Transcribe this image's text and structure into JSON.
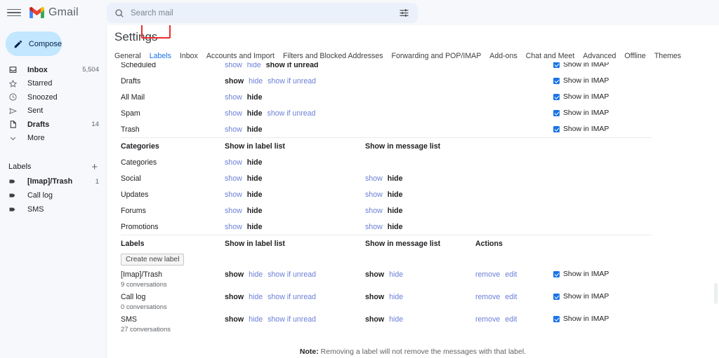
{
  "app": {
    "brand": "Gmail",
    "menu_icon": "hamburger-icon"
  },
  "search": {
    "placeholder": "Search mail",
    "value": "",
    "search_icon": "search-icon",
    "options_icon": "tune-icon"
  },
  "sidebar": {
    "compose": {
      "label": "Compose",
      "icon": "pencil-icon"
    },
    "nav": [
      {
        "label": "Inbox",
        "count": "5,504",
        "icon": "inbox-icon",
        "bold": true
      },
      {
        "label": "Starred",
        "count": "",
        "icon": "star-icon",
        "bold": false
      },
      {
        "label": "Snoozed",
        "count": "",
        "icon": "clock-icon",
        "bold": false
      },
      {
        "label": "Sent",
        "count": "",
        "icon": "send-icon",
        "bold": false
      },
      {
        "label": "Drafts",
        "count": "14",
        "icon": "draft-icon",
        "bold": true
      },
      {
        "label": "More",
        "count": "",
        "icon": "chevron-down-icon",
        "bold": false
      }
    ],
    "labels_header": {
      "title": "Labels",
      "add_icon": "plus-icon"
    },
    "labels": [
      {
        "label": "[Imap]/Trash",
        "count": "1",
        "bold": true
      },
      {
        "label": "Call log",
        "count": "",
        "bold": false
      },
      {
        "label": "SMS",
        "count": "",
        "bold": false
      }
    ]
  },
  "settings": {
    "title": "Settings",
    "tabs": [
      {
        "label": "General",
        "active": false
      },
      {
        "label": "Labels",
        "active": true
      },
      {
        "label": "Inbox",
        "active": false
      },
      {
        "label": "Accounts and Import",
        "active": false
      },
      {
        "label": "Filters and Blocked Addresses",
        "active": false
      },
      {
        "label": "Forwarding and POP/IMAP",
        "active": false
      },
      {
        "label": "Add-ons",
        "active": false
      },
      {
        "label": "Chat and Meet",
        "active": false
      },
      {
        "label": "Advanced",
        "active": false
      },
      {
        "label": "Offline",
        "active": false
      },
      {
        "label": "Themes",
        "active": false
      }
    ],
    "highlight_target": "Labels",
    "highlight_color": "#ee2b2b",
    "accent_color": "#1a73e8",
    "imap_checkbox_label": "Show in IMAP",
    "columns": {
      "show_in_label_list": "Show in label list",
      "show_in_message_list": "Show in message list",
      "actions": "Actions"
    },
    "system_rows": [
      {
        "name": "Scheduled",
        "list": [
          {
            "text": "show",
            "state": "link"
          },
          {
            "text": "hide",
            "state": "link"
          },
          {
            "text": "show if unread",
            "state": "selected"
          }
        ],
        "imap": true
      },
      {
        "name": "Drafts",
        "list": [
          {
            "text": "show",
            "state": "selected"
          },
          {
            "text": "hide",
            "state": "link"
          },
          {
            "text": "show if unread",
            "state": "link"
          }
        ],
        "imap": true
      },
      {
        "name": "All Mail",
        "list": [
          {
            "text": "show",
            "state": "link"
          },
          {
            "text": "hide",
            "state": "selected"
          }
        ],
        "imap": true
      },
      {
        "name": "Spam",
        "list": [
          {
            "text": "show",
            "state": "link"
          },
          {
            "text": "hide",
            "state": "selected"
          },
          {
            "text": "show if unread",
            "state": "link"
          }
        ],
        "imap": true
      },
      {
        "name": "Trash",
        "list": [
          {
            "text": "show",
            "state": "link"
          },
          {
            "text": "hide",
            "state": "selected"
          }
        ],
        "imap": true
      }
    ],
    "categories_section": {
      "header": "Categories",
      "rows": [
        {
          "name": "Categories",
          "list": [
            {
              "text": "show",
              "state": "link"
            },
            {
              "text": "hide",
              "state": "selected"
            }
          ],
          "msg": []
        },
        {
          "name": "Social",
          "list": [
            {
              "text": "show",
              "state": "link"
            },
            {
              "text": "hide",
              "state": "selected"
            }
          ],
          "msg": [
            {
              "text": "show",
              "state": "link"
            },
            {
              "text": "hide",
              "state": "selected"
            }
          ]
        },
        {
          "name": "Updates",
          "list": [
            {
              "text": "show",
              "state": "link"
            },
            {
              "text": "hide",
              "state": "selected"
            }
          ],
          "msg": [
            {
              "text": "show",
              "state": "link"
            },
            {
              "text": "hide",
              "state": "selected"
            }
          ]
        },
        {
          "name": "Forums",
          "list": [
            {
              "text": "show",
              "state": "link"
            },
            {
              "text": "hide",
              "state": "selected"
            }
          ],
          "msg": [
            {
              "text": "show",
              "state": "link"
            },
            {
              "text": "hide",
              "state": "selected"
            }
          ]
        },
        {
          "name": "Promotions",
          "list": [
            {
              "text": "show",
              "state": "link"
            },
            {
              "text": "hide",
              "state": "selected"
            }
          ],
          "msg": [
            {
              "text": "show",
              "state": "link"
            },
            {
              "text": "hide",
              "state": "selected"
            }
          ]
        }
      ]
    },
    "labels_section": {
      "header": "Labels",
      "create_button": "Create new label",
      "rows": [
        {
          "name": "[Imap]/Trash",
          "conversations": "9 conversations",
          "list": [
            {
              "text": "show",
              "state": "selected"
            },
            {
              "text": "hide",
              "state": "link"
            },
            {
              "text": "show if unread",
              "state": "link"
            }
          ],
          "msg": [
            {
              "text": "show",
              "state": "selected"
            },
            {
              "text": "hide",
              "state": "link"
            }
          ],
          "actions": [
            {
              "text": "remove"
            },
            {
              "text": "edit"
            }
          ],
          "imap": true
        },
        {
          "name": "Call log",
          "conversations": "0 conversations",
          "list": [
            {
              "text": "show",
              "state": "selected"
            },
            {
              "text": "hide",
              "state": "link"
            },
            {
              "text": "show if unread",
              "state": "link"
            }
          ],
          "msg": [
            {
              "text": "show",
              "state": "selected"
            },
            {
              "text": "hide",
              "state": "link"
            }
          ],
          "actions": [
            {
              "text": "remove"
            },
            {
              "text": "edit"
            }
          ],
          "imap": true
        },
        {
          "name": "SMS",
          "conversations": "27 conversations",
          "list": [
            {
              "text": "show",
              "state": "selected"
            },
            {
              "text": "hide",
              "state": "link"
            },
            {
              "text": "show if unread",
              "state": "link"
            }
          ],
          "msg": [
            {
              "text": "show",
              "state": "selected"
            },
            {
              "text": "hide",
              "state": "link"
            }
          ],
          "actions": [
            {
              "text": "remove"
            },
            {
              "text": "edit"
            }
          ],
          "imap": true
        }
      ]
    },
    "note_prefix": "Note:",
    "note_text": " Removing a label will not remove the messages with that label."
  }
}
